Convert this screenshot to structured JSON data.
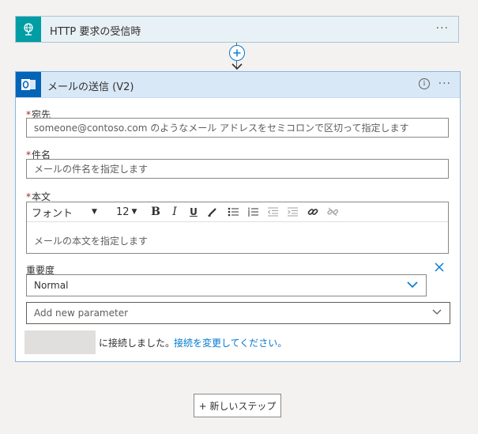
{
  "trigger": {
    "title": "HTTP 要求の受信時",
    "more": "···"
  },
  "connector": {
    "plus": "+"
  },
  "action": {
    "title": "メールの送信 (V2)",
    "info": "i",
    "more": "···",
    "to": {
      "required_mark": "*",
      "label": "宛先",
      "placeholder": "someone@contoso.com のようなメール アドレスをセミコロンで区切って指定します"
    },
    "subject": {
      "required_mark": "*",
      "label": "件名",
      "placeholder": "メールの件名を指定します"
    },
    "body": {
      "required_mark": "*",
      "label": "本文",
      "font": "フォント",
      "font_caret": "▼",
      "size": "12",
      "size_caret": "▼",
      "bold": "B",
      "italic": "I",
      "underline": "U",
      "placeholder": "メールの本文を指定します"
    },
    "importance": {
      "label": "重要度",
      "value": "Normal"
    },
    "add_param": {
      "placeholder": "Add new parameter"
    },
    "connection": {
      "text": "に接続しました。",
      "link": "接続を変更してください。"
    }
  },
  "new_step": {
    "label": "+ 新しいステップ"
  }
}
